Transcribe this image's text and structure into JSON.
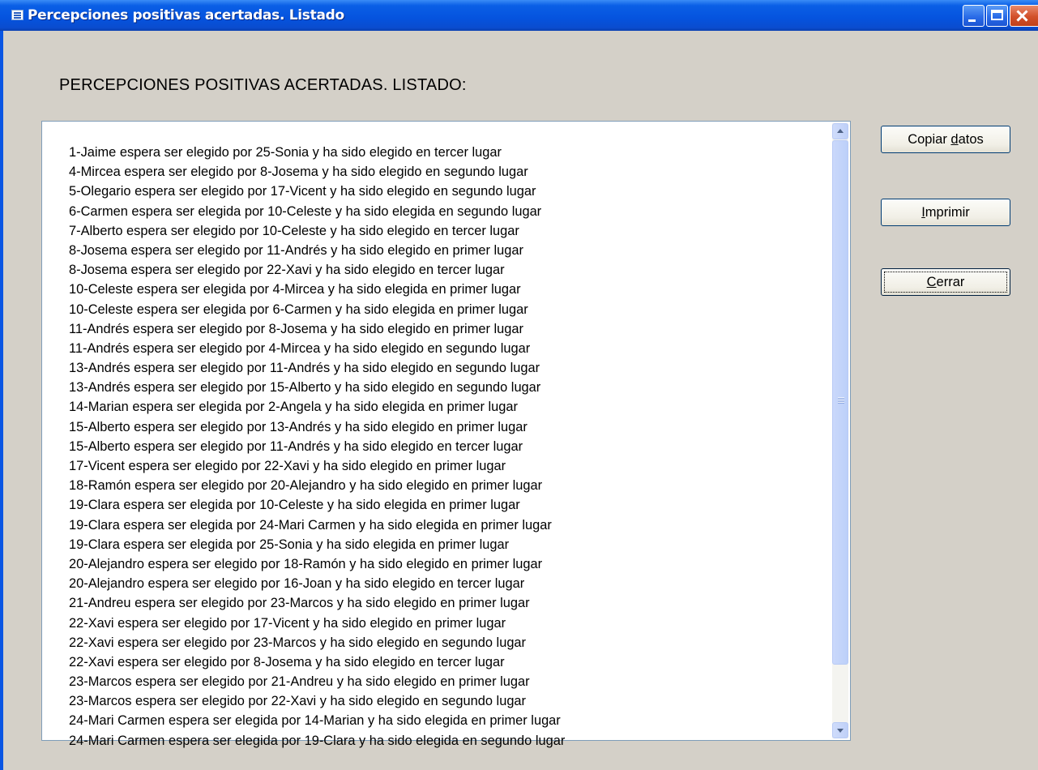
{
  "window": {
    "title": "Percepciones positivas acertadas. Listado"
  },
  "heading": "PERCEPCIONES POSITIVAS ACERTADAS.  LISTADO:",
  "list": {
    "items": [
      "1-Jaime espera ser elegido por 25-Sonia y ha sido elegido en tercer lugar",
      "4-Mircea espera ser elegido por 8-Josema y ha sido elegido en segundo lugar",
      "5-Olegario espera ser elegido por 17-Vicent y ha sido elegido en segundo lugar",
      "6-Carmen espera ser elegida por 10-Celeste y ha sido elegida en segundo lugar",
      "7-Alberto espera ser elegido por 10-Celeste y ha sido elegido en tercer lugar",
      "8-Josema espera ser elegido por 11-Andrés y ha sido elegido en primer lugar",
      "8-Josema espera ser elegido por 22-Xavi y ha sido elegido en tercer lugar",
      "10-Celeste espera ser elegida por 4-Mircea y ha sido elegida en primer lugar",
      "10-Celeste espera ser elegida por 6-Carmen y ha sido elegida en primer lugar",
      "11-Andrés espera ser elegido por 8-Josema y ha sido elegido en primer lugar",
      "11-Andrés espera ser elegido por 4-Mircea y ha sido elegido en segundo lugar",
      "13-Andrés espera ser elegido por 11-Andrés y ha sido elegido en segundo lugar",
      "13-Andrés espera ser elegido por 15-Alberto y ha sido elegido en segundo lugar",
      "14-Marian espera ser elegida por 2-Angela y ha sido elegida en primer lugar",
      "15-Alberto espera ser elegido por 13-Andrés y ha sido elegido en primer lugar",
      "15-Alberto espera ser elegido por 11-Andrés y ha sido elegido en tercer lugar",
      "17-Vicent espera ser elegido por 22-Xavi y ha sido elegido en primer lugar",
      "18-Ramón espera ser elegido por 20-Alejandro y ha sido elegido en primer lugar",
      "19-Clara espera ser elegida por 10-Celeste y ha sido elegida en primer lugar",
      "19-Clara espera ser elegida por 24-Mari Carmen y ha sido elegida en primer lugar",
      "19-Clara espera ser elegida por 25-Sonia y ha sido elegida en primer lugar",
      "20-Alejandro espera ser elegido por 18-Ramón y ha sido elegido en primer lugar",
      "20-Alejandro espera ser elegido por 16-Joan y ha sido elegido en tercer lugar",
      "21-Andreu espera ser elegido por 23-Marcos y ha sido elegido en primer lugar",
      "22-Xavi espera ser elegido por 17-Vicent y ha sido elegido en primer lugar",
      "22-Xavi espera ser elegido por 23-Marcos y ha sido elegido en segundo lugar",
      "22-Xavi espera ser elegido por 8-Josema y ha sido elegido en tercer lugar",
      "23-Marcos espera ser elegido por 21-Andreu y ha sido elegido en primer lugar",
      "23-Marcos espera ser elegido por 22-Xavi y ha sido elegido en segundo lugar",
      "24-Mari Carmen espera ser elegida por 14-Marian y ha sido elegida en primer lugar",
      "24-Mari Carmen espera ser elegida por 19-Clara y ha sido elegida en segundo lugar"
    ]
  },
  "buttons": {
    "copiar": {
      "label": "Copiar datos",
      "access_key": "d"
    },
    "imprimir": {
      "label": "Imprimir",
      "access_key": "I"
    },
    "cerrar": {
      "label": "Cerrar",
      "access_key": "C"
    }
  },
  "icons": {
    "window_icon": "app-window-icon",
    "minimize": "minimize-icon",
    "maximize": "maximize-icon",
    "close": "close-icon",
    "scroll_up": "chevron-up-icon",
    "scroll_down": "chevron-down-icon"
  },
  "colors": {
    "titlebar": "#0a55e3",
    "client_background": "#d4d0c8",
    "close_button": "#d2502a"
  }
}
